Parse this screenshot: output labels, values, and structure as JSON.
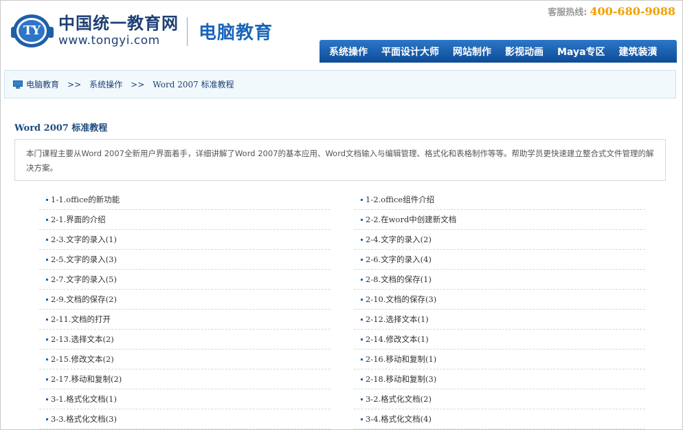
{
  "header": {
    "logo_badge": "TY",
    "logo_cn": "中国统一教育网",
    "logo_url": "www.tongyi.com",
    "site_sub": "电脑教育",
    "hotline_label": "客服热线:",
    "hotline_number": "400-680-9088"
  },
  "nav": {
    "items": [
      {
        "label": "系统操作"
      },
      {
        "label": "平面设计大师"
      },
      {
        "label": "网站制作"
      },
      {
        "label": "影视动画"
      },
      {
        "label": "Maya专区"
      },
      {
        "label": "建筑装潢"
      }
    ]
  },
  "breadcrumb": {
    "items": [
      "电脑教育",
      "系统操作",
      "Word 2007 标准教程"
    ],
    "separator": ">>"
  },
  "course": {
    "title": "Word 2007 标准教程",
    "description": "本门课程主要从Word 2007全新用户界面着手，详细讲解了Word 2007的基本应用、Word文档输入与编辑管理、格式化和表格制作等等。帮助学员更快速建立整合式文件管理的解决方案。"
  },
  "lessons": {
    "left": [
      "1-1.office的新功能",
      "2-1.界面的介绍",
      "2-3.文字的录入(1)",
      "2-5.文字的录入(3)",
      "2-7.文字的录入(5)",
      "2-9.文档的保存(2)",
      "2-11.文档的打开",
      "2-13.选择文本(2)",
      "2-15.修改文本(2)",
      "2-17.移动和复制(2)",
      "3-1.格式化文档(1)",
      "3-3.格式化文档(3)"
    ],
    "right": [
      "1-2.office组件介绍",
      "2-2.在word中创建新文档",
      "2-4.文字的录入(2)",
      "2-6.文字的录入(4)",
      "2-8.文档的保存(1)",
      "2-10.文档的保存(3)",
      "2-12.选择文本(1)",
      "2-14.修改文本(1)",
      "2-16.移动和复制(1)",
      "2-18.移动和复制(3)",
      "3-2.格式化文档(2)",
      "3-4.格式化文档(4)"
    ]
  },
  "colors": {
    "brand_blue": "#1a65b9",
    "nav_gradient_top": "#2c77c8",
    "nav_gradient_bottom": "#0d4b97",
    "hotline": "#f0a000"
  }
}
